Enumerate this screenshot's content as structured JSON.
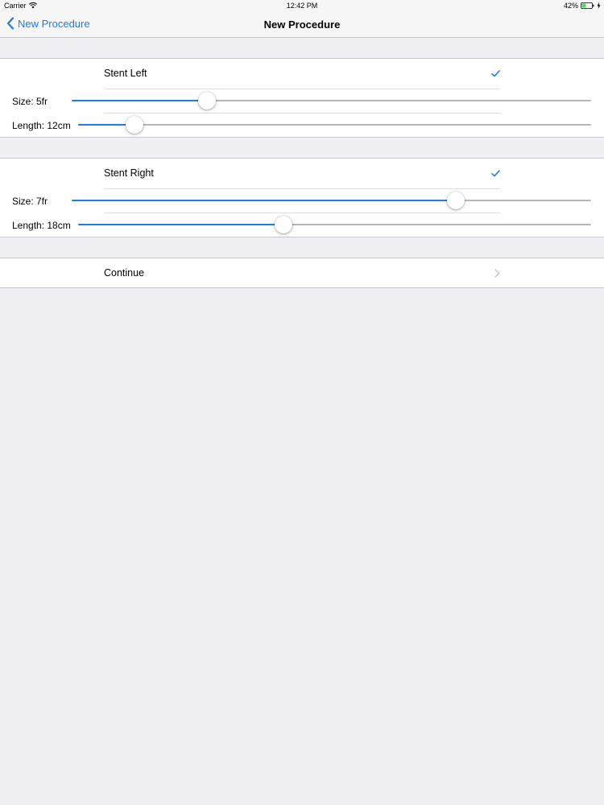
{
  "status_bar": {
    "carrier": "Carrier",
    "wifi_icon": "wifi-icon",
    "time": "12:42 PM",
    "battery_percent": "42%",
    "battery_level": 0.42,
    "battery_icon": "battery-icon",
    "charging_icon": "bolt-icon"
  },
  "nav": {
    "back_label": "New Procedure",
    "back_icon": "chevron-left-icon",
    "title": "New Procedure"
  },
  "colors": {
    "accent": "#1a7cf4",
    "background": "#efeff4",
    "track": "#b7b7b7"
  },
  "stents": [
    {
      "title": "Stent Left",
      "checked": true,
      "check_icon": "checkmark-icon",
      "size": {
        "label": "Size: 5fr",
        "value_fraction": 0.26
      },
      "length": {
        "label": "Length: 12cm",
        "value_fraction": 0.11
      }
    },
    {
      "title": "Stent Right",
      "checked": true,
      "check_icon": "checkmark-icon",
      "size": {
        "label": "Size: 7fr",
        "value_fraction": 0.74
      },
      "length": {
        "label": "Length: 18cm",
        "value_fraction": 0.4
      }
    }
  ],
  "continue": {
    "label": "Continue",
    "icon": "chevron-right-icon"
  }
}
